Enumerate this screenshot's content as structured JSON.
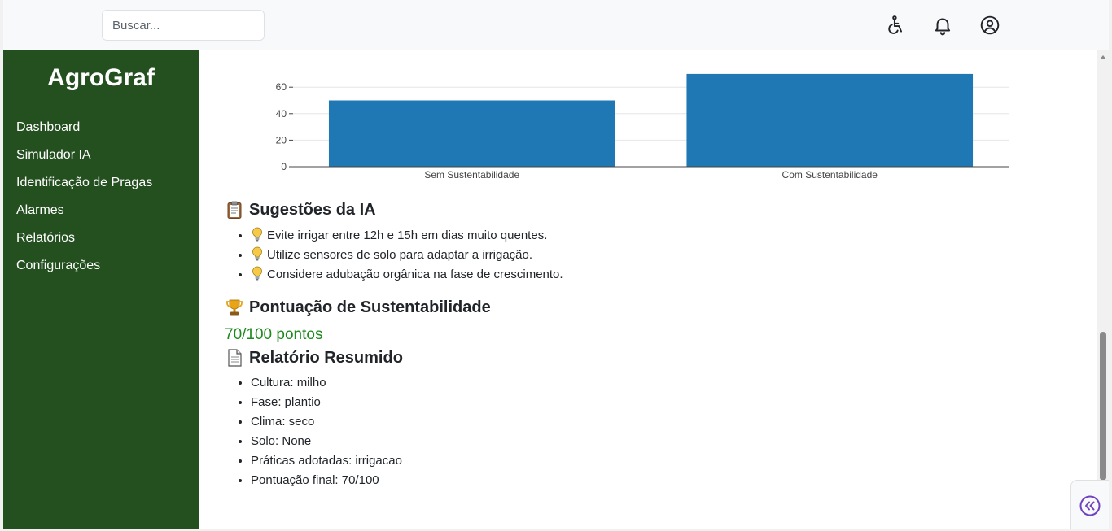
{
  "search": {
    "placeholder": "Buscar..."
  },
  "header": {
    "icons": [
      "accessibility-icon",
      "bell-icon",
      "user-circle-icon"
    ]
  },
  "sidebar": {
    "brand": "AgroGraf",
    "items": [
      {
        "label": "Dashboard"
      },
      {
        "label": "Simulador IA"
      },
      {
        "label": "Identificação de Pragas"
      },
      {
        "label": "Alarmes"
      },
      {
        "label": "Relatórios"
      },
      {
        "label": "Configurações"
      }
    ]
  },
  "chart_data": {
    "type": "bar",
    "categories": [
      "Sem Sustentabilidade",
      "Com Sustentabilidade"
    ],
    "values": [
      50,
      70
    ],
    "yticks": [
      "0",
      "20",
      "40",
      "60"
    ],
    "ylim": [
      0,
      70
    ],
    "bar_color": "#1f77b4",
    "grid": true
  },
  "suggestions": {
    "title": "Sugestões da IA",
    "items": [
      "Evite irrigar entre 12h e 15h em dias muito quentes.",
      "Utilize sensores de solo para adaptar a irrigação.",
      "Considere adubação orgânica na fase de crescimento."
    ]
  },
  "score": {
    "title": "Pontuação de Sustentabilidade",
    "value": "70/100 pontos"
  },
  "report": {
    "title": "Relatório Resumido",
    "items": [
      "Cultura: milho",
      "Fase: plantio",
      "Clima: seco",
      "Solo: None",
      "Práticas adotadas: irrigacao",
      "Pontuação final: 70/100"
    ]
  },
  "colors": {
    "sidebar": "#245020",
    "score": "#1e8a1e",
    "fab_icon": "#6f42c1"
  }
}
